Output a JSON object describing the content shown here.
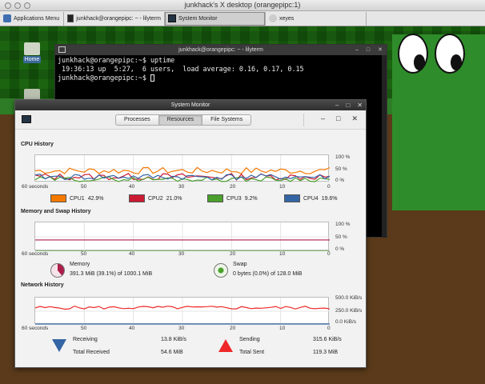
{
  "mac_window": {
    "title": "junkhack's X desktop (orangepipc:1)"
  },
  "taskbar": {
    "items": [
      {
        "label": "Applications Menu"
      },
      {
        "label": "junkhack@orangepipc: ~ - lilyterm"
      },
      {
        "label": "System Monitor"
      },
      {
        "label": "xeyes"
      }
    ]
  },
  "desktop": {
    "icons": [
      {
        "label": "Home"
      }
    ]
  },
  "terminal": {
    "title": "junkhack@orangepipc: ~ - lilyterm",
    "lines": [
      "junkhack@orangepipc:~$ uptime",
      " 19:36:13 up  5:27,  6 users,  load average: 0.16, 0.17, 0.15",
      "junkhack@orangepipc:~$ "
    ]
  },
  "system_monitor": {
    "title": "System Monitor",
    "tabs": [
      "Processes",
      "Resources",
      "File Systems"
    ],
    "selected_tab": "Resources",
    "x_labels": [
      "60 seconds",
      "50",
      "40",
      "30",
      "20",
      "10",
      "0"
    ],
    "cpu": {
      "heading": "CPU History",
      "y_labels": [
        "100 %",
        "50 %",
        "0 %"
      ],
      "legend": [
        {
          "name": "CPU1",
          "value": "42.9%",
          "color": "#f57900"
        },
        {
          "name": "CPU2",
          "value": "21.0%",
          "color": "#cc1a33"
        },
        {
          "name": "CPU3",
          "value": "9.2%",
          "color": "#4aa02c"
        },
        {
          "name": "CPU4",
          "value": "19.6%",
          "color": "#3465a4"
        }
      ]
    },
    "memory": {
      "heading": "Memory and Swap History",
      "y_labels": [
        "100 %",
        "50 %",
        "0 %"
      ],
      "memory_label": "Memory",
      "memory_value": "391.3 MiB (39.1%) of 1000.1 MiB",
      "memory_color": "#ad1f4b",
      "swap_label": "Swap",
      "swap_value": "0 bytes (0.0%) of 128.0 MiB",
      "swap_color": "#4aa02c"
    },
    "network": {
      "heading": "Network History",
      "y_labels": [
        "500.0 KiB/s",
        "250.0 KiB/s",
        "0.0 KiB/s"
      ],
      "receiving_label": "Receiving",
      "receiving_value": "13.8 KiB/s",
      "total_received_label": "Total Received",
      "total_received_value": "54.6 MiB",
      "sending_label": "Sending",
      "sending_value": "315.6 KiB/s",
      "total_sent_label": "Total Sent",
      "total_sent_value": "119.3 MiB",
      "receiving_color": "#3465a4",
      "sending_color": "#ef2929"
    }
  }
}
